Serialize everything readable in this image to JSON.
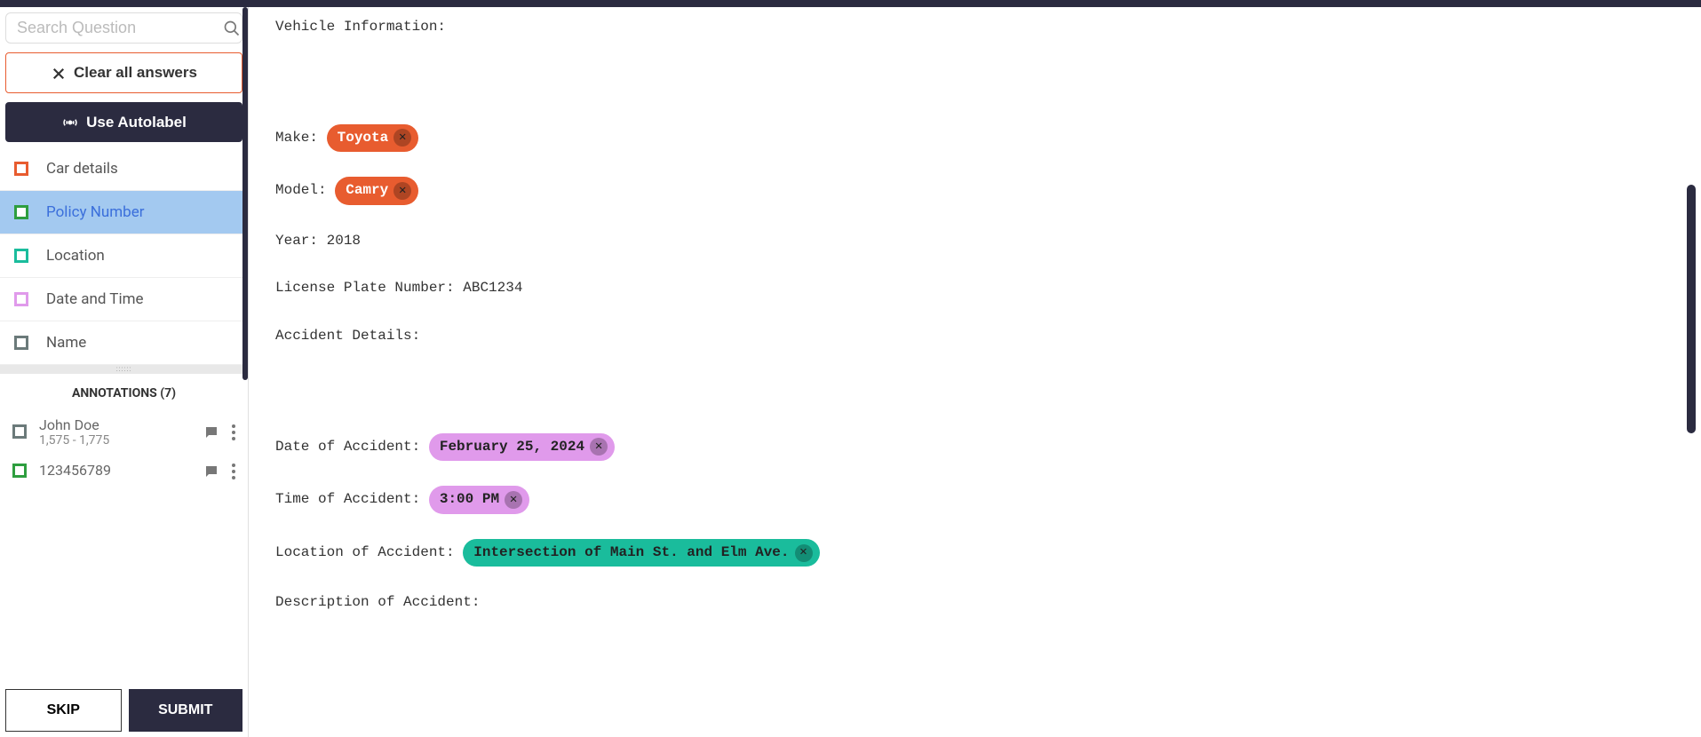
{
  "search": {
    "placeholder": "Search Question"
  },
  "buttons": {
    "clear": "Clear all answers",
    "autolabel": "Use Autolabel",
    "skip": "SKIP",
    "submit": "SUBMIT"
  },
  "labels": [
    {
      "name": "Car details",
      "color": "#e85c2f"
    },
    {
      "name": "Policy Number",
      "color": "#2e9e3f"
    },
    {
      "name": "Location",
      "color": "#1abc9c"
    },
    {
      "name": "Date and Time",
      "color": "#e09aeb"
    },
    {
      "name": "Name",
      "color": "#6b7a7a"
    }
  ],
  "annotations_header": "ANNOTATIONS (7)",
  "annotations": [
    {
      "name": "John Doe",
      "range": "1,575 - 1,775",
      "color": "#6b7a7a"
    },
    {
      "name": "123456789",
      "range": "",
      "color": "#2e9e3f"
    }
  ],
  "doc": {
    "vehicle_info": "Vehicle Information:",
    "make_label": "Make:",
    "make_tag": "Toyota",
    "model_label": "Model:",
    "model_tag": "Camry",
    "year_line": "Year: 2018",
    "plate_line": "License Plate Number: ABC1234",
    "accident_details": "Accident Details:",
    "date_label": "Date of Accident:",
    "date_tag": "February 25, 2024",
    "time_label": "Time of Accident:",
    "time_tag": "3:00 PM",
    "location_label": "Location of Accident:",
    "location_tag": "Intersection of Main St. and Elm Ave.",
    "description": "Description of Accident:"
  }
}
